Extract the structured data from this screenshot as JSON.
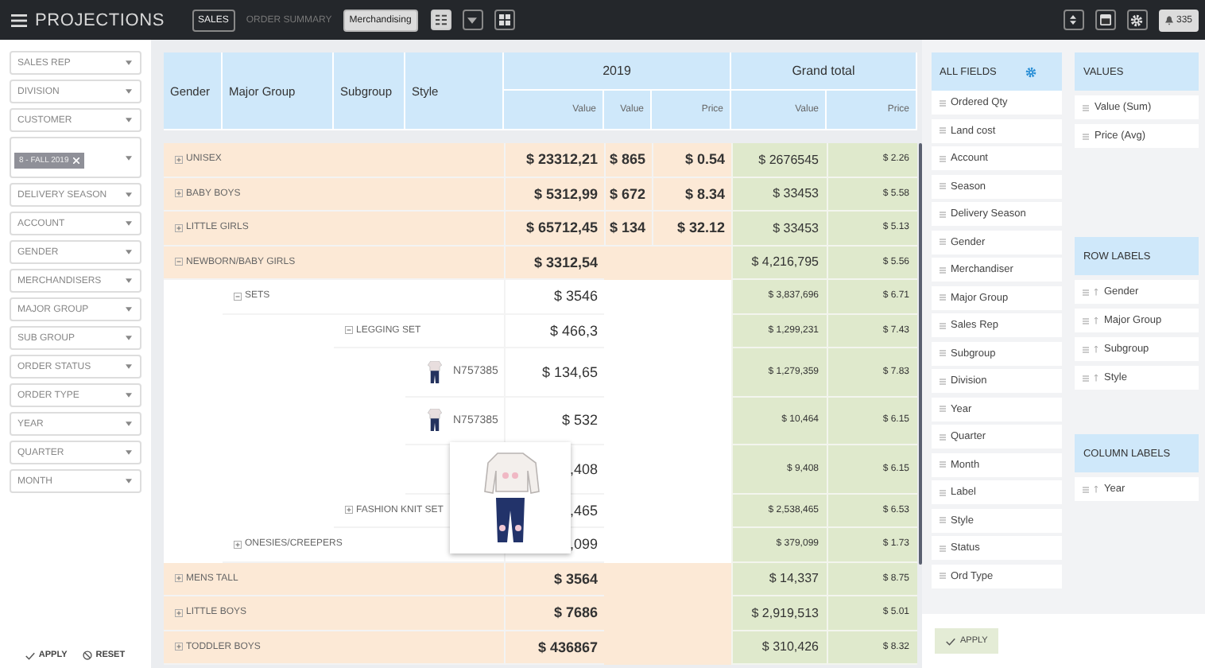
{
  "topbar": {
    "title": "PROJECTIONS",
    "tabs": [
      {
        "label": "SALES",
        "selected": false,
        "outlined": true
      },
      {
        "label": "ORDER SUMMARY",
        "selected": false,
        "outlined": false
      },
      {
        "label": "Merchandising",
        "selected": true,
        "outlined": false
      }
    ],
    "notifications": "335"
  },
  "filters": {
    "items": [
      {
        "kind": "select",
        "label": "SALES REP"
      },
      {
        "kind": "select",
        "label": "DIVISION"
      },
      {
        "kind": "select",
        "label": "CUSTOMER"
      },
      {
        "kind": "tags",
        "tags": [
          "8 - FALL 2019"
        ]
      },
      {
        "kind": "select",
        "label": "DELIVERY SEASON"
      },
      {
        "kind": "select",
        "label": "ACCOUNT"
      },
      {
        "kind": "select",
        "label": "GENDER"
      },
      {
        "kind": "select",
        "label": "MERCHANDISERS"
      },
      {
        "kind": "select",
        "label": "MAJOR GROUP"
      },
      {
        "kind": "select",
        "label": "SUB GROUP"
      },
      {
        "kind": "select",
        "label": "ORDER STATUS"
      },
      {
        "kind": "select",
        "label": "ORDER TYPE"
      },
      {
        "kind": "select",
        "label": "YEAR"
      },
      {
        "kind": "select",
        "label": "QUARTER"
      },
      {
        "kind": "select",
        "label": "MONTH"
      }
    ],
    "apply": "APPLY",
    "reset": "RESET"
  },
  "table": {
    "columns": [
      "Gender",
      "Major Group",
      "Subgroup",
      "Style"
    ],
    "groups": [
      {
        "label": "2019",
        "columns": [
          "Value",
          "Value",
          "Price"
        ]
      },
      {
        "label": "Grand total",
        "columns": [
          "Value",
          "Price"
        ]
      }
    ],
    "rows": [
      {
        "kind": "group",
        "label": "UNISEX",
        "expanded": false,
        "value_2019": "$ 23312,21",
        "value_2019_b": "$ 865",
        "price_2019": "$ 0.54",
        "total_value": "$ 2676545",
        "total_price": "$ 2.26"
      },
      {
        "kind": "group",
        "label": "BABY BOYS",
        "expanded": false,
        "value_2019": "$ 5312,99",
        "value_2019_b": "$ 672",
        "price_2019": "$ 8.34",
        "total_value": "$ 33453",
        "total_price": "$ 5.58"
      },
      {
        "kind": "group",
        "label": "LITTLE GIRLS",
        "expanded": false,
        "value_2019": "$ 65712,45",
        "value_2019_b": "$ 134",
        "price_2019": "$ 32.12",
        "total_value": "$ 33453",
        "total_price": "$ 5.13"
      },
      {
        "kind": "group",
        "label": "NEWBORN/BABY GIRLS",
        "expanded": true,
        "value_2019": "$ 3312,54",
        "total_value": "$ 4,216,795",
        "total_price": "$ 5.56",
        "children": [
          {
            "kind": "group",
            "label": "SETS",
            "expanded": true,
            "value_2019": "$ 3546",
            "total_value": "$ 3,837,696",
            "total_price": "$ 6.71",
            "children": [
              {
                "kind": "group",
                "label": "LEGGING SET",
                "expanded": true,
                "value_2019": "$ 466,3",
                "total_value": "$ 1,299,231",
                "total_price": "$ 7.43",
                "children": [
                  {
                    "kind": "style",
                    "label": "N757385",
                    "value_2019": "$ 134,65",
                    "total_value": "$ 1,279,359",
                    "total_price": "$ 7.83"
                  },
                  {
                    "kind": "style",
                    "label": "N757385",
                    "value_2019": "$ 532",
                    "total_value": "$ 10,464",
                    "total_price": "$ 6.15"
                  },
                  {
                    "kind": "style",
                    "value_2019": ",408",
                    "total_value": "$ 9,408",
                    "total_price": "$ 6.15"
                  }
                ]
              },
              {
                "kind": "group",
                "label": "FASHION KNIT SET",
                "expanded": false,
                "value_2019": ",465",
                "total_value": "$ 2,538,465",
                "total_price": "$ 6.53"
              }
            ]
          },
          {
            "kind": "group",
            "label": "ONESIES/CREEPERS",
            "expanded": false,
            "value_2019": ",099",
            "total_value": "$ 379,099",
            "total_price": "$ 1.73"
          }
        ]
      },
      {
        "kind": "group",
        "label": "MENS TALL",
        "expanded": false,
        "value_2019": "$ 3564",
        "total_value": "$ 14,337",
        "total_price": "$ 8.75"
      },
      {
        "kind": "group",
        "label": "LITTLE BOYS",
        "expanded": false,
        "value_2019": "$ 7686",
        "total_value": "$ 2,919,513",
        "total_price": "$ 5.01"
      },
      {
        "kind": "group",
        "label": "TODDLER BOYS",
        "expanded": false,
        "value_2019": "$ 436867",
        "total_value": "$ 310,426",
        "total_price": "$ 8.32"
      }
    ]
  },
  "preview_popup": {
    "open": true
  },
  "all_fields": {
    "title": "ALL FIELDS",
    "items": [
      "Ordered Qty",
      "Land cost",
      "Account",
      "Season",
      "Delivery Season",
      "Gender",
      "Merchandiser",
      "Major Group",
      "Sales Rep",
      "Subgroup",
      "Division",
      "Year",
      "Quarter",
      "Month",
      "Label",
      "Style",
      "Status",
      "Ord Type"
    ]
  },
  "values": {
    "title": "VALUES",
    "items": [
      "Value (Sum)",
      "Price (Avg)"
    ]
  },
  "row_labels": {
    "title": "ROW LABELS",
    "items": [
      "Gender",
      "Major Group",
      "Subgroup",
      "Style"
    ]
  },
  "column_labels": {
    "title": "COLUMN LABELS",
    "items": [
      "Year"
    ]
  },
  "apply": "APPLY"
}
